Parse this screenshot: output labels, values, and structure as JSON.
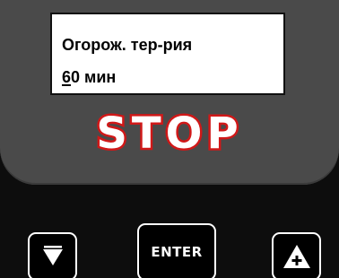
{
  "display": {
    "line1": "Огорож. тер-рия",
    "line2_cursor_char": "6",
    "line2_rest": "0 мин"
  },
  "status": {
    "text": "STOP",
    "fill_color": "#ffffff",
    "outline_color": "#d01818"
  },
  "buttons": {
    "down_icon": "triangle-down-icon",
    "enter_label": "ENTER",
    "up_icon": "triangle-up-plus-icon"
  },
  "colors": {
    "panel": "#4a4a4a",
    "body": "#0d0d0d",
    "lcd": "#ffffff"
  }
}
